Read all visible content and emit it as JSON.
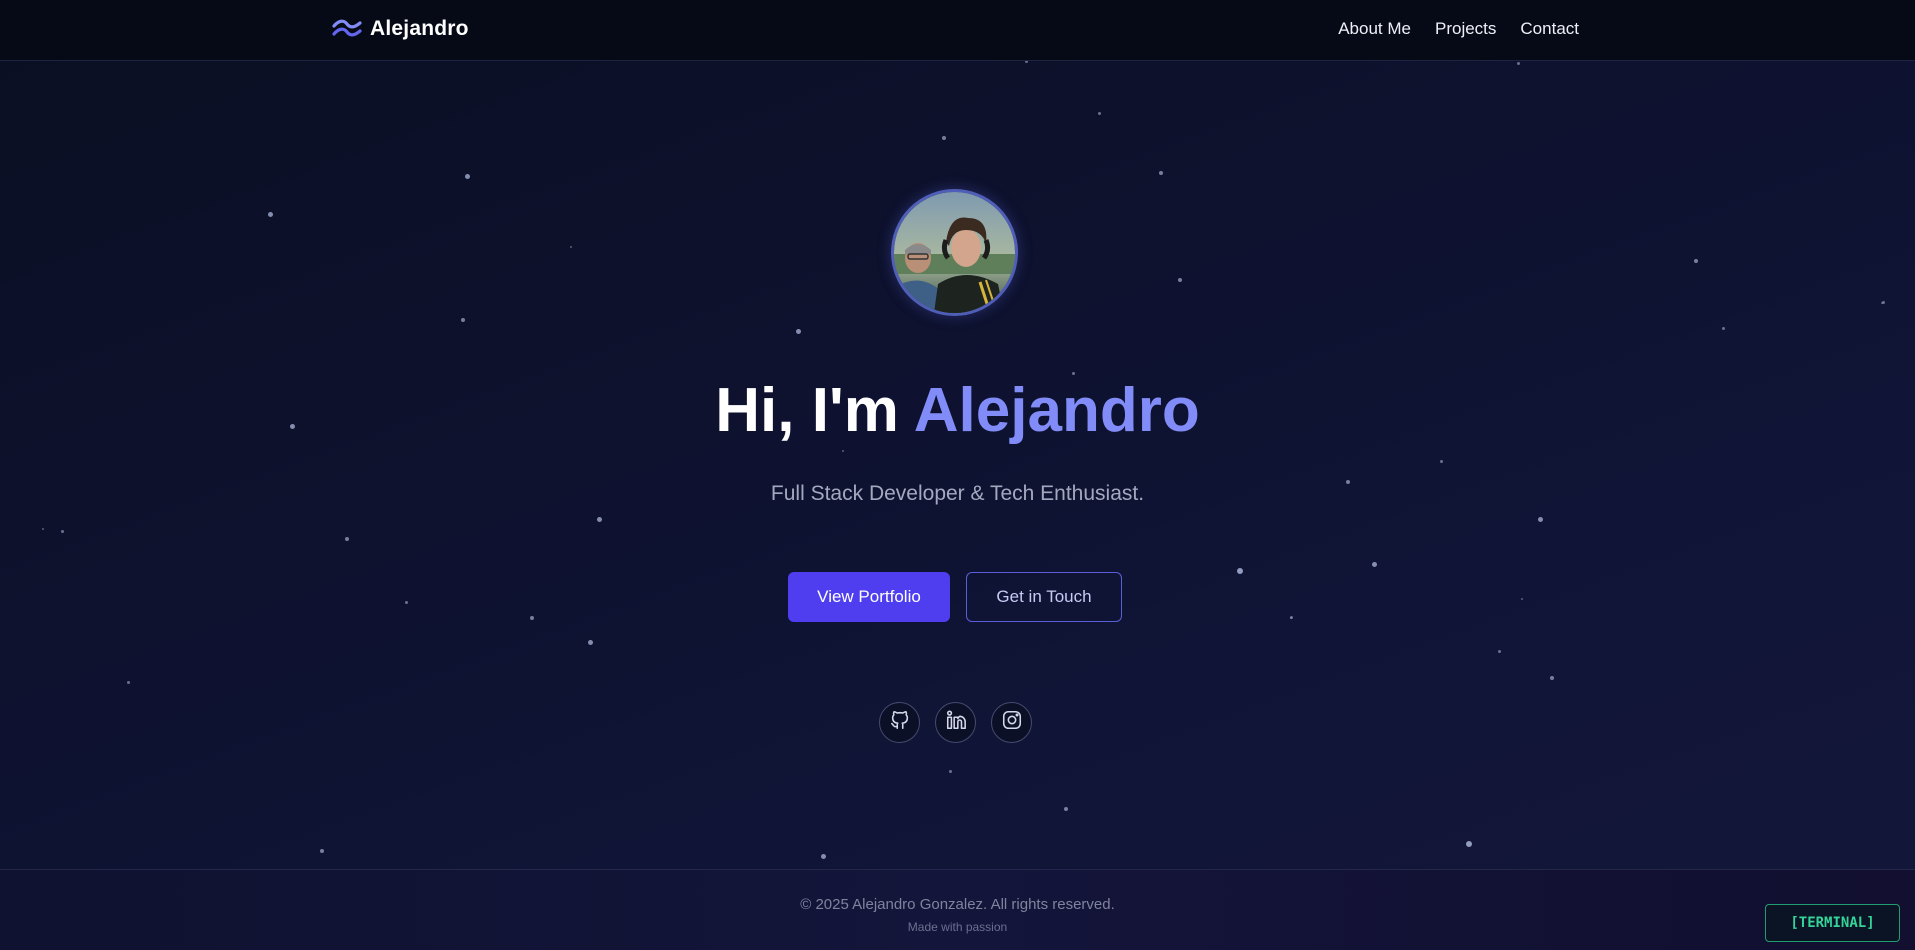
{
  "header": {
    "brand_name": "Alejandro",
    "brand_icon": "wave-logo-icon",
    "nav": [
      {
        "label": "About Me"
      },
      {
        "label": "Projects"
      },
      {
        "label": "Contact"
      }
    ]
  },
  "hero": {
    "greeting": "Hi, I'm ",
    "name": "Alejandro",
    "subtitle": "Full Stack Developer & Tech Enthusiast.",
    "primary_button": "View Portfolio",
    "secondary_button": "Get in Touch",
    "avatar_icon": "profile-photo",
    "socials": [
      {
        "icon": "github-icon"
      },
      {
        "icon": "linkedin-icon"
      },
      {
        "icon": "instagram-icon"
      }
    ]
  },
  "footer": {
    "copyright": "© 2025 Alejandro Gonzalez. All rights reserved.",
    "made_with": "Made with passion",
    "terminal_label": "[TERMINAL]"
  },
  "colors": {
    "accent": "#818cf8",
    "primary_button": "#4f3df0",
    "terminal_green": "#34d399",
    "header_bg": "#060a17"
  }
}
